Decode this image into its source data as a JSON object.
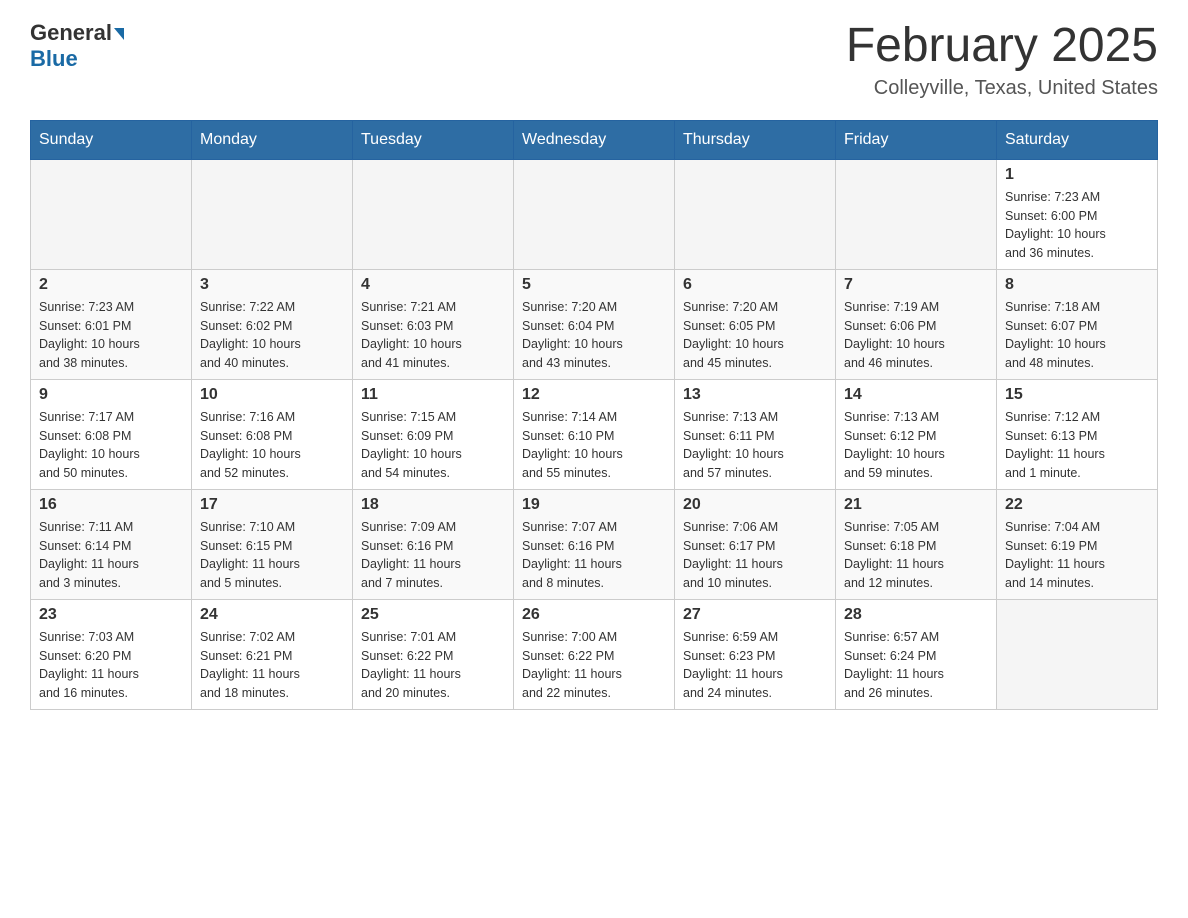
{
  "header": {
    "logo_general": "General",
    "logo_blue": "Blue",
    "calendar_title": "February 2025",
    "calendar_subtitle": "Colleyville, Texas, United States"
  },
  "weekdays": [
    "Sunday",
    "Monday",
    "Tuesday",
    "Wednesday",
    "Thursday",
    "Friday",
    "Saturday"
  ],
  "weeks": [
    [
      {
        "day": "",
        "info": ""
      },
      {
        "day": "",
        "info": ""
      },
      {
        "day": "",
        "info": ""
      },
      {
        "day": "",
        "info": ""
      },
      {
        "day": "",
        "info": ""
      },
      {
        "day": "",
        "info": ""
      },
      {
        "day": "1",
        "info": "Sunrise: 7:23 AM\nSunset: 6:00 PM\nDaylight: 10 hours\nand 36 minutes."
      }
    ],
    [
      {
        "day": "2",
        "info": "Sunrise: 7:23 AM\nSunset: 6:01 PM\nDaylight: 10 hours\nand 38 minutes."
      },
      {
        "day": "3",
        "info": "Sunrise: 7:22 AM\nSunset: 6:02 PM\nDaylight: 10 hours\nand 40 minutes."
      },
      {
        "day": "4",
        "info": "Sunrise: 7:21 AM\nSunset: 6:03 PM\nDaylight: 10 hours\nand 41 minutes."
      },
      {
        "day": "5",
        "info": "Sunrise: 7:20 AM\nSunset: 6:04 PM\nDaylight: 10 hours\nand 43 minutes."
      },
      {
        "day": "6",
        "info": "Sunrise: 7:20 AM\nSunset: 6:05 PM\nDaylight: 10 hours\nand 45 minutes."
      },
      {
        "day": "7",
        "info": "Sunrise: 7:19 AM\nSunset: 6:06 PM\nDaylight: 10 hours\nand 46 minutes."
      },
      {
        "day": "8",
        "info": "Sunrise: 7:18 AM\nSunset: 6:07 PM\nDaylight: 10 hours\nand 48 minutes."
      }
    ],
    [
      {
        "day": "9",
        "info": "Sunrise: 7:17 AM\nSunset: 6:08 PM\nDaylight: 10 hours\nand 50 minutes."
      },
      {
        "day": "10",
        "info": "Sunrise: 7:16 AM\nSunset: 6:08 PM\nDaylight: 10 hours\nand 52 minutes."
      },
      {
        "day": "11",
        "info": "Sunrise: 7:15 AM\nSunset: 6:09 PM\nDaylight: 10 hours\nand 54 minutes."
      },
      {
        "day": "12",
        "info": "Sunrise: 7:14 AM\nSunset: 6:10 PM\nDaylight: 10 hours\nand 55 minutes."
      },
      {
        "day": "13",
        "info": "Sunrise: 7:13 AM\nSunset: 6:11 PM\nDaylight: 10 hours\nand 57 minutes."
      },
      {
        "day": "14",
        "info": "Sunrise: 7:13 AM\nSunset: 6:12 PM\nDaylight: 10 hours\nand 59 minutes."
      },
      {
        "day": "15",
        "info": "Sunrise: 7:12 AM\nSunset: 6:13 PM\nDaylight: 11 hours\nand 1 minute."
      }
    ],
    [
      {
        "day": "16",
        "info": "Sunrise: 7:11 AM\nSunset: 6:14 PM\nDaylight: 11 hours\nand 3 minutes."
      },
      {
        "day": "17",
        "info": "Sunrise: 7:10 AM\nSunset: 6:15 PM\nDaylight: 11 hours\nand 5 minutes."
      },
      {
        "day": "18",
        "info": "Sunrise: 7:09 AM\nSunset: 6:16 PM\nDaylight: 11 hours\nand 7 minutes."
      },
      {
        "day": "19",
        "info": "Sunrise: 7:07 AM\nSunset: 6:16 PM\nDaylight: 11 hours\nand 8 minutes."
      },
      {
        "day": "20",
        "info": "Sunrise: 7:06 AM\nSunset: 6:17 PM\nDaylight: 11 hours\nand 10 minutes."
      },
      {
        "day": "21",
        "info": "Sunrise: 7:05 AM\nSunset: 6:18 PM\nDaylight: 11 hours\nand 12 minutes."
      },
      {
        "day": "22",
        "info": "Sunrise: 7:04 AM\nSunset: 6:19 PM\nDaylight: 11 hours\nand 14 minutes."
      }
    ],
    [
      {
        "day": "23",
        "info": "Sunrise: 7:03 AM\nSunset: 6:20 PM\nDaylight: 11 hours\nand 16 minutes."
      },
      {
        "day": "24",
        "info": "Sunrise: 7:02 AM\nSunset: 6:21 PM\nDaylight: 11 hours\nand 18 minutes."
      },
      {
        "day": "25",
        "info": "Sunrise: 7:01 AM\nSunset: 6:22 PM\nDaylight: 11 hours\nand 20 minutes."
      },
      {
        "day": "26",
        "info": "Sunrise: 7:00 AM\nSunset: 6:22 PM\nDaylight: 11 hours\nand 22 minutes."
      },
      {
        "day": "27",
        "info": "Sunrise: 6:59 AM\nSunset: 6:23 PM\nDaylight: 11 hours\nand 24 minutes."
      },
      {
        "day": "28",
        "info": "Sunrise: 6:57 AM\nSunset: 6:24 PM\nDaylight: 11 hours\nand 26 minutes."
      },
      {
        "day": "",
        "info": ""
      }
    ]
  ]
}
